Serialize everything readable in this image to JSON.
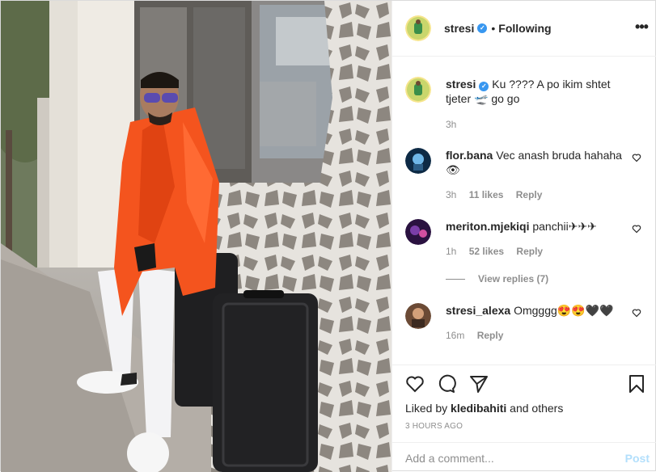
{
  "post": {
    "author": "stresi",
    "separator": "•",
    "follow_label": "Following",
    "more_label": "•••",
    "verified_mark": "✓"
  },
  "caption": {
    "user": "stresi",
    "text": "Ku ???? A po ikim shtet tjeter 🛫 go go",
    "time": "3h"
  },
  "comments": [
    {
      "user": "flor.bana",
      "text": "Vec anash bruda hahaha 👁",
      "time": "3h",
      "likes": "11 likes",
      "reply": "Reply"
    },
    {
      "user": "meriton.mjekiqi",
      "text": "panchii✈✈✈",
      "time": "1h",
      "likes": "52 likes",
      "reply": "Reply"
    },
    {
      "user": "stresi_alexa",
      "text": "Omgggg😍😍🖤🖤",
      "time": "16m",
      "likes": "",
      "reply": "Reply"
    }
  ],
  "view_replies": "View replies (7)",
  "likes": {
    "prefix": "Liked by",
    "user": "kledibahiti",
    "suffix": "and others"
  },
  "timestamp": "3 HOURS AGO",
  "composer": {
    "placeholder": "Add a comment...",
    "post_label": "Post"
  },
  "colors": {
    "coat": "#f4541e",
    "verified": "#3897f0",
    "post_disabled": "#b2dffc",
    "meta": "#8e8e8e"
  },
  "icons": [
    "heart-icon",
    "comment-icon",
    "share-icon",
    "bookmark-icon",
    "more-options-icon",
    "verified-icon"
  ]
}
